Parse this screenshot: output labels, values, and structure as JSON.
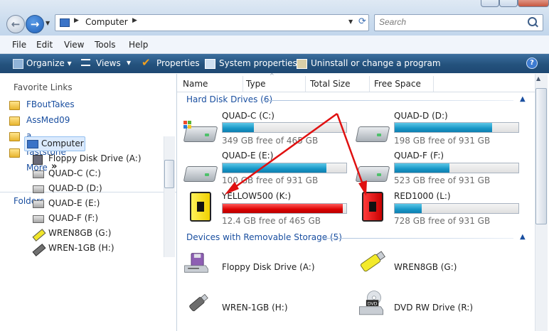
{
  "window": {
    "address": {
      "location": "Computer",
      "separator": "▶"
    },
    "search": {
      "placeholder": "Search"
    }
  },
  "menu": [
    "File",
    "Edit",
    "View",
    "Tools",
    "Help"
  ],
  "toolbar": {
    "organize": "Organize",
    "views": "Views",
    "properties": "Properties",
    "system_properties": "System properties",
    "uninstall": "Uninstall or change a program"
  },
  "sidebar": {
    "favorites_title": "Favorite Links",
    "favorites": [
      "FBoutTakes",
      "AssMed09",
      "a",
      "faststone"
    ],
    "more": "More",
    "folders_title": "Folders",
    "tree": [
      {
        "label": "Computer",
        "icon": "computer-icon"
      },
      {
        "label": "Floppy Disk Drive (A:)",
        "icon": "floppy-icon"
      },
      {
        "label": "QUAD-C (C:)",
        "icon": "hdd-icon"
      },
      {
        "label": "QUAD-D (D:)",
        "icon": "hdd-icon"
      },
      {
        "label": "QUAD-E (E:)",
        "icon": "hdd-icon"
      },
      {
        "label": "QUAD-F (F:)",
        "icon": "hdd-icon"
      },
      {
        "label": "WREN8GB (G:)",
        "icon": "usb-icon"
      },
      {
        "label": "WREN-1GB (H:)",
        "icon": "usb-icon"
      }
    ]
  },
  "columns": [
    "Name",
    "Type",
    "Total Size",
    "Free Space"
  ],
  "groups": {
    "hard_disks": {
      "title": "Hard Disk Drives (6)",
      "drives": [
        {
          "name": "QUAD-C (C:)",
          "free": "349 GB free of 465 GB",
          "used_fraction": 0.25,
          "color": "#1796c6",
          "icon": "system-hdd-icon"
        },
        {
          "name": "QUAD-D (D:)",
          "free": "198 GB free of 931 GB",
          "used_fraction": 0.79,
          "color": "#1796c6",
          "icon": "hdd-icon"
        },
        {
          "name": "QUAD-E (E:)",
          "free": "100 GB free of 931 GB",
          "used_fraction": 0.84,
          "color": "#1796c6",
          "icon": "hdd-icon"
        },
        {
          "name": "QUAD-F (F:)",
          "free": "523 GB free of 931 GB",
          "used_fraction": 0.44,
          "color": "#1796c6",
          "icon": "hdd-icon"
        },
        {
          "name": "YELLOW500 (K:)",
          "free": "12.4 GB free of 465 GB",
          "used_fraction": 0.97,
          "color": "#dc0000",
          "icon": "yellow-drive-icon"
        },
        {
          "name": "RED1000 (L:)",
          "free": "728 GB free of 931 GB",
          "used_fraction": 0.22,
          "color": "#1796c6",
          "icon": "red-drive-icon"
        }
      ]
    },
    "removable": {
      "title": "Devices with Removable Storage (5)",
      "devices": [
        {
          "name": "Floppy Disk Drive (A:)",
          "icon": "floppy-icon"
        },
        {
          "name": "WREN8GB (G:)",
          "icon": "usb-icon"
        },
        {
          "name": "WREN-1GB (H:)",
          "icon": "usb-icon"
        },
        {
          "name": "DVD RW Drive (R:)",
          "icon": "dvd-icon",
          "icon_label": "DVD"
        }
      ]
    }
  },
  "annotation_color": "#e01010"
}
